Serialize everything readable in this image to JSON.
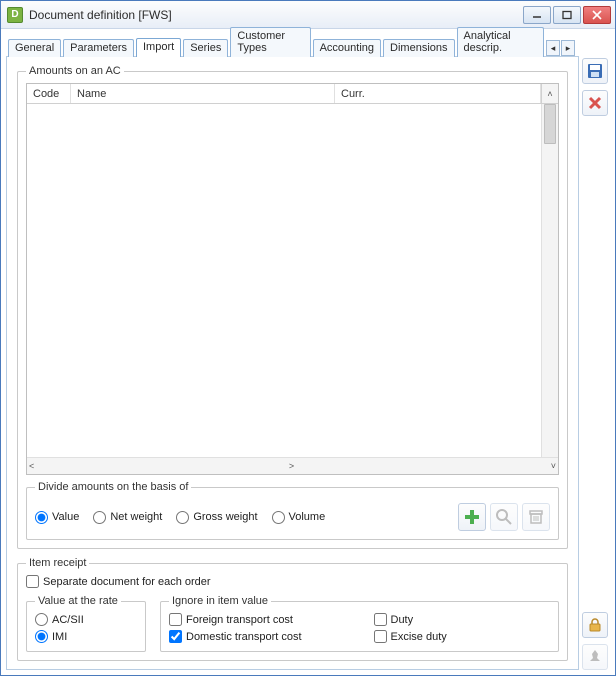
{
  "window": {
    "title": "Document definition [FWS]"
  },
  "tabs": {
    "items": [
      {
        "label": "General"
      },
      {
        "label": "Parameters"
      },
      {
        "label": "Import"
      },
      {
        "label": "Series"
      },
      {
        "label": "Customer Types"
      },
      {
        "label": "Accounting"
      },
      {
        "label": "Dimensions"
      },
      {
        "label": "Analytical descrip."
      }
    ],
    "active_index": 2
  },
  "amounts_group": {
    "legend": "Amounts on an AC",
    "columns": {
      "code": "Code",
      "name": "Name",
      "curr": "Curr."
    }
  },
  "divide_group": {
    "legend": "Divide amounts on the basis of",
    "options": {
      "value": "Value",
      "net": "Net weight",
      "gross": "Gross weight",
      "volume": "Volume"
    },
    "selected": "value"
  },
  "item_receipt": {
    "legend": "Item receipt",
    "separate_doc": {
      "label": "Separate document for each order",
      "checked": false
    },
    "rate_group": {
      "legend": "Value at the rate",
      "options": {
        "acsii": "AC/SII",
        "imi": "IMI"
      },
      "selected": "imi"
    },
    "ignore_group": {
      "legend": "Ignore in item value",
      "options": {
        "foreign": {
          "label": "Foreign transport cost",
          "checked": false
        },
        "domestic": {
          "label": "Domestic transport cost",
          "checked": true
        },
        "duty": {
          "label": "Duty",
          "checked": false
        },
        "excise": {
          "label": "Excise duty",
          "checked": false
        }
      }
    }
  },
  "icons": {
    "save": "save-icon",
    "delete": "delete-icon",
    "add": "plus-icon",
    "search": "magnifier-icon",
    "trash": "trash-icon",
    "lock": "lock-icon",
    "pin": "pin-icon"
  }
}
